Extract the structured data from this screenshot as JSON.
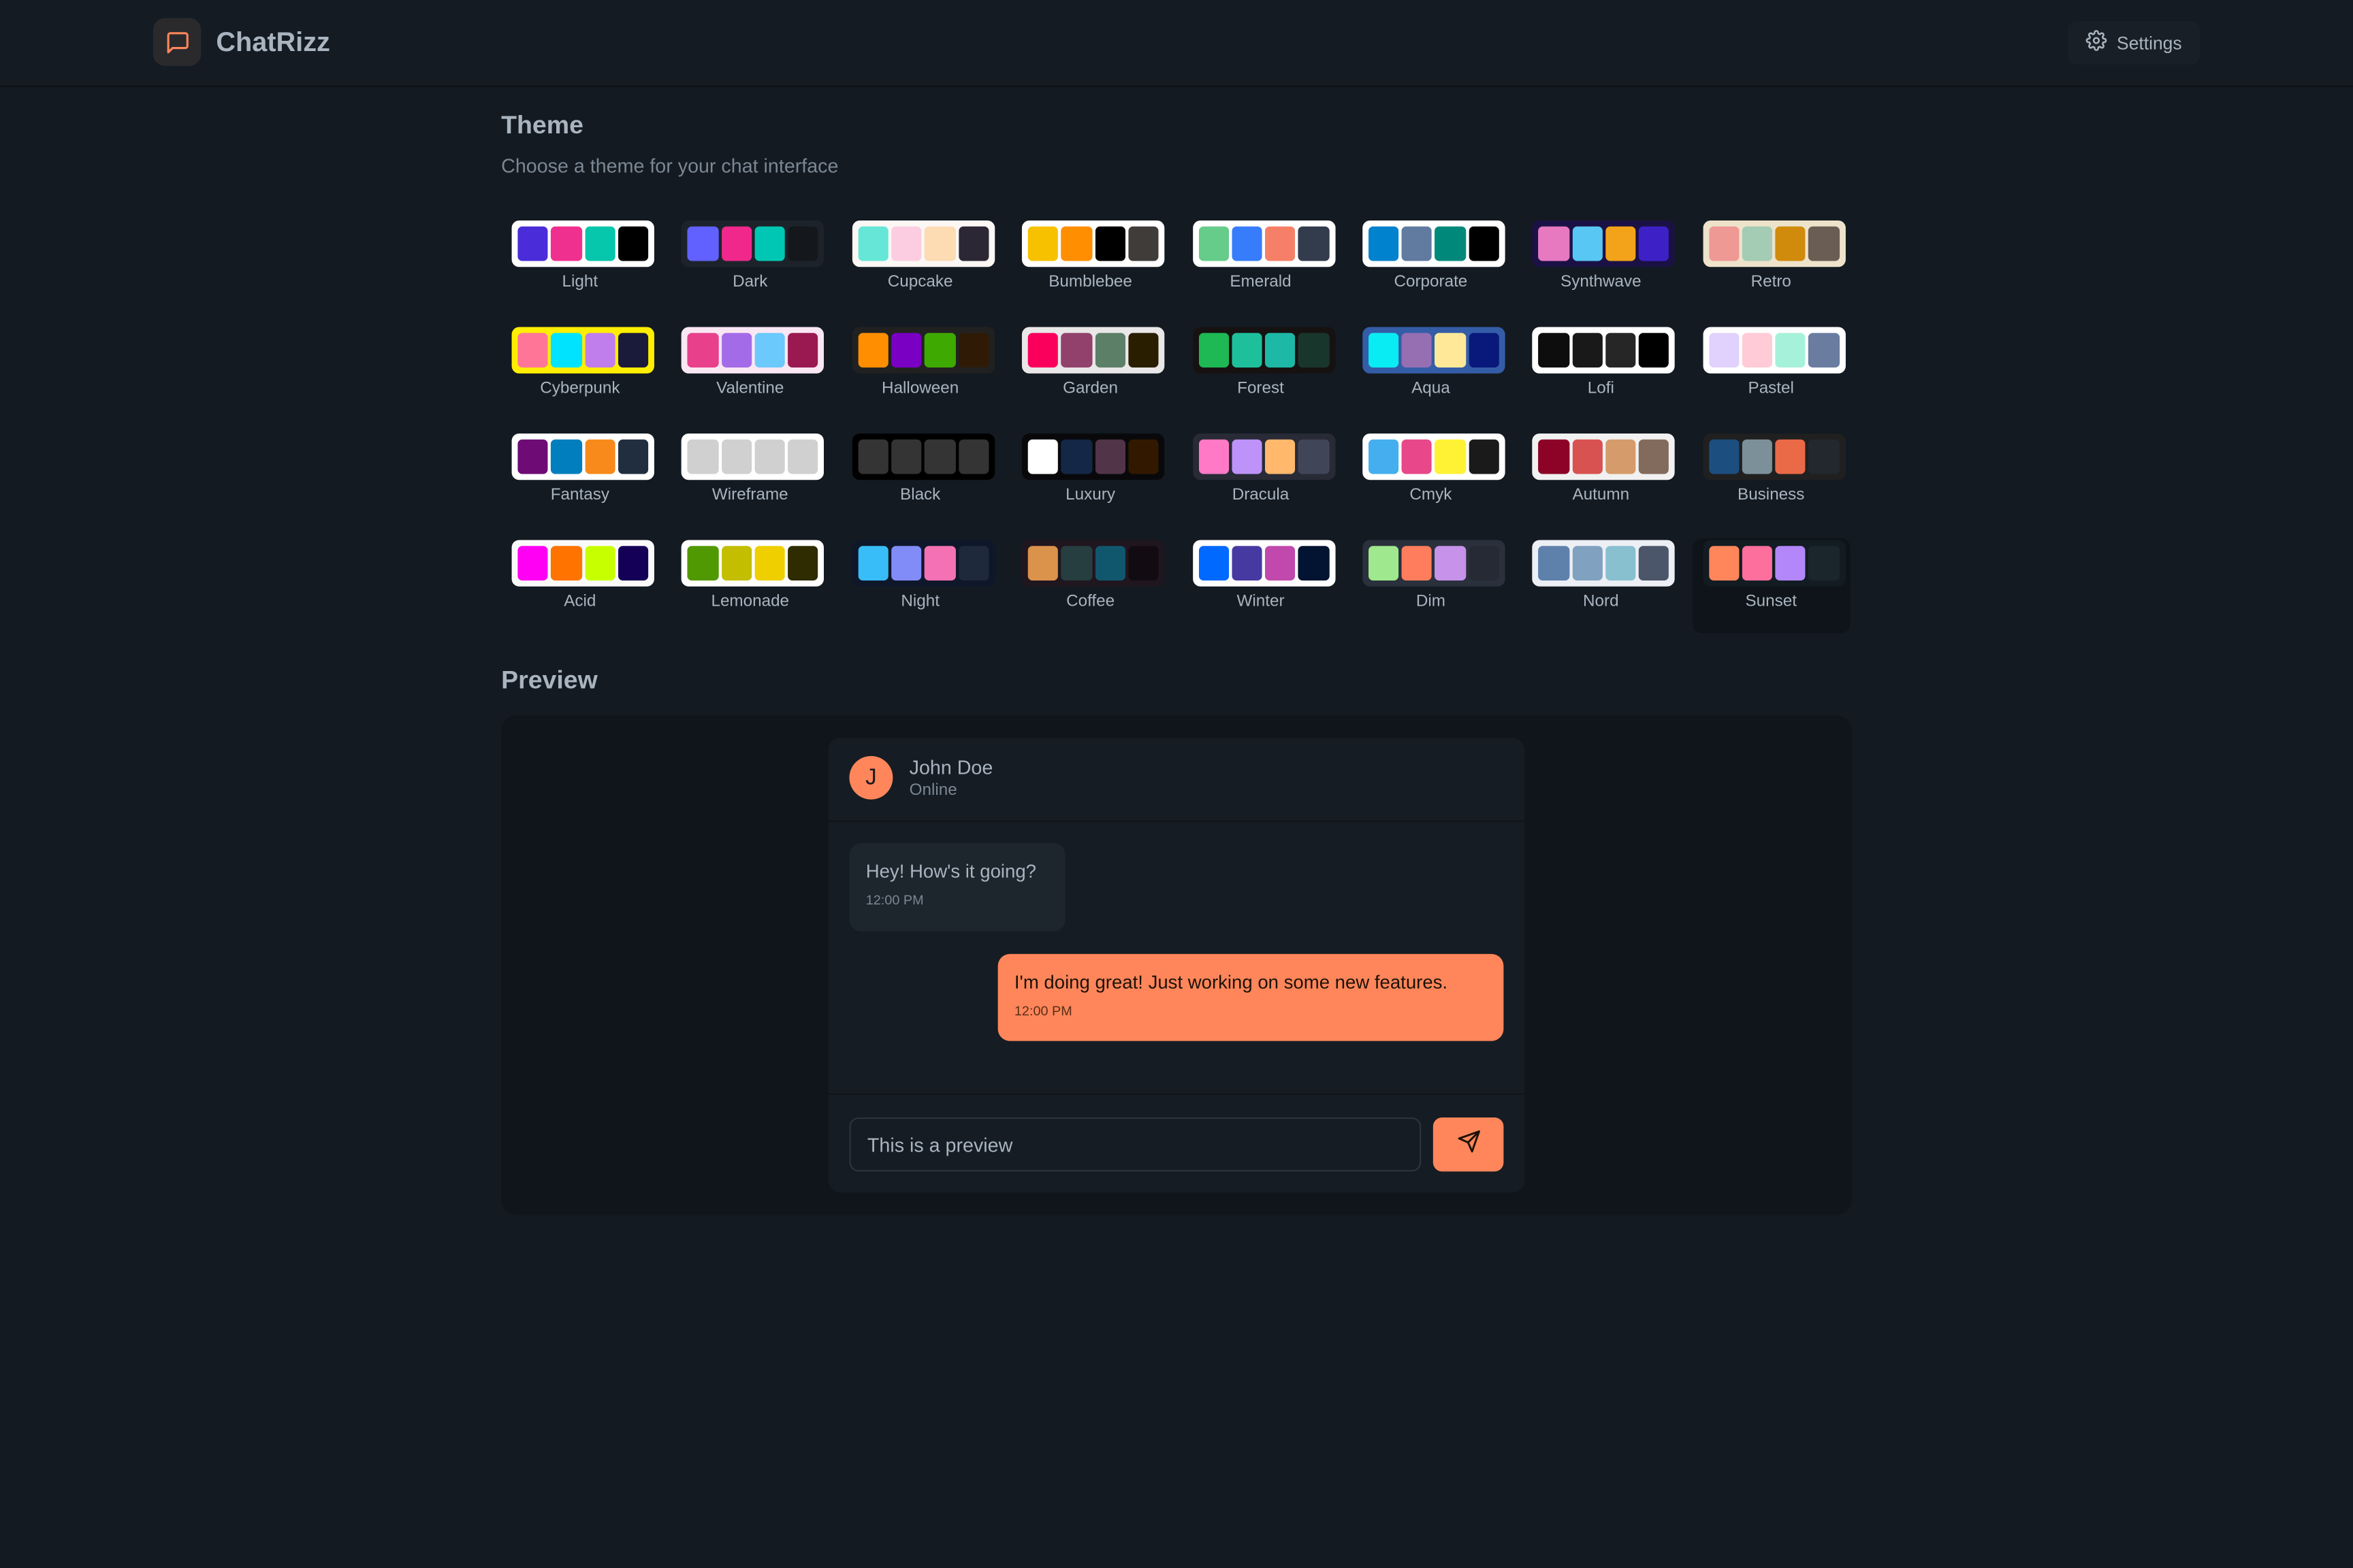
{
  "app": {
    "name": "ChatRizz",
    "brand_icon": "message-square-icon",
    "accent": "#ff865b",
    "background": "#131a21"
  },
  "navbar": {
    "settings_label": "Settings",
    "settings_icon": "gear-icon"
  },
  "theme_section": {
    "title": "Theme",
    "subtitle": "Choose a theme for your chat interface",
    "selected": "Sunset",
    "themes": [
      {
        "name": "Light",
        "bg": "#ffffff",
        "colors": [
          "#4a2dd9",
          "#f0308e",
          "#06c6ab",
          "#000000"
        ]
      },
      {
        "name": "Dark",
        "bg": "#1d232a",
        "colors": [
          "#6161ff",
          "#f0288c",
          "#00c7b3",
          "#14181d"
        ]
      },
      {
        "name": "Cupcake",
        "bg": "#faf7f5",
        "colors": [
          "#65e6d6",
          "#fccde0",
          "#fddbb3",
          "#2b2734"
        ]
      },
      {
        "name": "Bumblebee",
        "bg": "#ffffff",
        "colors": [
          "#f7c100",
          "#ff8e00",
          "#000000",
          "#3f3c3a"
        ]
      },
      {
        "name": "Emerald",
        "bg": "#ffffff",
        "colors": [
          "#66cc8a",
          "#377cfb",
          "#f68067",
          "#333c4d"
        ]
      },
      {
        "name": "Corporate",
        "bg": "#ffffff",
        "colors": [
          "#0082ce",
          "#617aa0",
          "#00897b",
          "#000000"
        ]
      },
      {
        "name": "Synthwave",
        "bg": "#1b1145",
        "colors": [
          "#e779c1",
          "#58c7f3",
          "#f3a31a",
          "#3e21c6"
        ]
      },
      {
        "name": "Retro",
        "bg": "#ece3ca",
        "colors": [
          "#ef9995",
          "#a4cbb4",
          "#d08b0d",
          "#6a5e54"
        ]
      },
      {
        "name": "Cyberpunk",
        "bg": "#ffee00",
        "colors": [
          "#ff7598",
          "#00e3ff",
          "#c07eec",
          "#1a1b3a"
        ]
      },
      {
        "name": "Valentine",
        "bg": "#fae7f4",
        "colors": [
          "#e9408c",
          "#a46be8",
          "#6cc9fb",
          "#9a1950"
        ]
      },
      {
        "name": "Halloween",
        "bg": "#212121",
        "colors": [
          "#ff8f00",
          "#7a00c4",
          "#3ea900",
          "#2f1b05"
        ]
      },
      {
        "name": "Garden",
        "bg": "#e9e7e7",
        "colors": [
          "#fa005c",
          "#91416c",
          "#5c7f67",
          "#291e00"
        ]
      },
      {
        "name": "Forest",
        "bg": "#171212",
        "colors": [
          "#1eb854",
          "#1ec09c",
          "#1db9a6",
          "#19362d"
        ]
      },
      {
        "name": "Aqua",
        "bg": "#345da7",
        "colors": [
          "#09ecf3",
          "#966fb3",
          "#ffe999",
          "#09197b"
        ]
      },
      {
        "name": "Lofi",
        "bg": "#ffffff",
        "colors": [
          "#0d0d0d",
          "#1a1919",
          "#262626",
          "#000000"
        ]
      },
      {
        "name": "Pastel",
        "bg": "#ffffff",
        "colors": [
          "#e1d1fd",
          "#ffcbd6",
          "#a6f1da",
          "#6a7da1"
        ]
      },
      {
        "name": "Fantasy",
        "bg": "#ffffff",
        "colors": [
          "#6e0b75",
          "#007ebd",
          "#f88a1b",
          "#212e40"
        ]
      },
      {
        "name": "Wireframe",
        "bg": "#ffffff",
        "colors": [
          "#d0d0d0",
          "#d0d0d0",
          "#d0d0d0",
          "#d0d0d0"
        ]
      },
      {
        "name": "Black",
        "bg": "#000000",
        "colors": [
          "#343434",
          "#343434",
          "#343434",
          "#343434"
        ]
      },
      {
        "name": "Luxury",
        "bg": "#09090b",
        "colors": [
          "#ffffff",
          "#152747",
          "#513448",
          "#331800"
        ]
      },
      {
        "name": "Dracula",
        "bg": "#282a36",
        "colors": [
          "#ff79c6",
          "#bd93f9",
          "#ffb86c",
          "#414558"
        ]
      },
      {
        "name": "Cmyk",
        "bg": "#ffffff",
        "colors": [
          "#45aeee",
          "#e8488a",
          "#fff234",
          "#1a1a1a"
        ]
      },
      {
        "name": "Autumn",
        "bg": "#f1f1f1",
        "colors": [
          "#8c0327",
          "#d85251",
          "#d59b6a",
          "#826a5c"
        ]
      },
      {
        "name": "Business",
        "bg": "#202020",
        "colors": [
          "#1c4e80",
          "#7c909a",
          "#ea6947",
          "#23282e"
        ]
      },
      {
        "name": "Acid",
        "bg": "#fafafa",
        "colors": [
          "#ff00f4",
          "#ff7400",
          "#c8ff00",
          "#140157"
        ]
      },
      {
        "name": "Lemonade",
        "bg": "#ffffff",
        "colors": [
          "#519903",
          "#c4be00",
          "#efcf00",
          "#2e2c00"
        ]
      },
      {
        "name": "Night",
        "bg": "#0f172a",
        "colors": [
          "#38bdf8",
          "#818cf8",
          "#f471b5",
          "#1e293b"
        ]
      },
      {
        "name": "Coffee",
        "bg": "#20161f",
        "colors": [
          "#db924b",
          "#263e3f",
          "#10576d",
          "#120c12"
        ]
      },
      {
        "name": "Winter",
        "bg": "#ffffff",
        "colors": [
          "#0069ff",
          "#463aa2",
          "#c148ac",
          "#021431"
        ]
      },
      {
        "name": "Dim",
        "bg": "#2a303c",
        "colors": [
          "#9fe88d",
          "#ff7d5c",
          "#c792e9",
          "#252a34"
        ]
      },
      {
        "name": "Nord",
        "bg": "#eceff4",
        "colors": [
          "#5e81ac",
          "#81a1c1",
          "#88c0d0",
          "#4c566a"
        ]
      },
      {
        "name": "Sunset",
        "bg": "#121c22",
        "colors": [
          "#ff865b",
          "#fd6f9c",
          "#b387fa",
          "#1b262c"
        ]
      }
    ]
  },
  "preview": {
    "title": "Preview",
    "contact": {
      "initial": "J",
      "name": "John Doe",
      "status": "Online"
    },
    "messages": [
      {
        "text": "Hey! How's it going?",
        "time": "12:00 PM",
        "outgoing": false
      },
      {
        "text": "I'm doing great! Just working on some new features.",
        "time": "12:00 PM",
        "outgoing": true
      }
    ],
    "input_value": "This is a preview",
    "send_icon": "send-icon"
  }
}
